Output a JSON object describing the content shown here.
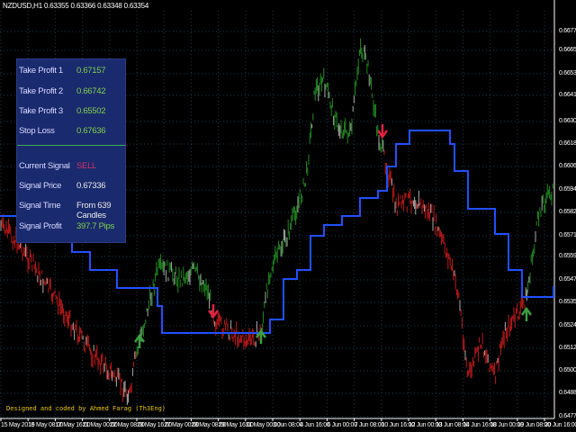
{
  "header": {
    "title": "NZDUSD,H1  0.63355 0.63366 0.63348 0.63354"
  },
  "panel": {
    "rows": [
      {
        "label": "Take Profit 1",
        "value": "0.67157",
        "color": "#7fd04a"
      },
      {
        "label": "Take Profit 2",
        "value": "0.66742",
        "color": "#7fd04a"
      },
      {
        "label": "Take Profit 3",
        "value": "0.65502",
        "color": "#7fd04a"
      },
      {
        "label": "Stop Loss",
        "value": "0.67636",
        "color": "#7fd04a"
      },
      {
        "label": "Current Signal",
        "value": "SELL",
        "color": "#d0306a"
      },
      {
        "label": "Signal Price",
        "value": "0.67336",
        "color": "#e8e8e8"
      },
      {
        "label": "Signal Time",
        "value": "From 639 Candles",
        "color": "#e8e8e8"
      },
      {
        "label": "Signal Profit",
        "value": "397.7  Pips",
        "color": "#7fd04a"
      }
    ]
  },
  "credit": "Designed and coded by Ahmed Farag (Th3Eng)",
  "price_axis": [
    "0.66770",
    "0.66650",
    "0.66535",
    "0.66415",
    "0.66300",
    "0.66180",
    "0.66065",
    "0.65945",
    "0.65825",
    "0.65710",
    "0.65590",
    "0.65475",
    "0.65355",
    "0.65240",
    "0.65120",
    "0.65005",
    "0.64885",
    "0.64770"
  ],
  "time_axis": [
    "15 May 2019",
    "16 May 08:00",
    "17 May 16:00",
    "21 May 00:00",
    "22 May 08:00",
    "23 May 16:00",
    "27 May 00:00",
    "28 May 08:00",
    "29 May 16:00",
    "31 May 00:00",
    "3 Jun 08:00",
    "4 Jun 16:00",
    "6 Jun 00:00",
    "7 Jun 08:00",
    "10 Jun 16:00",
    "12 Jun 00:00",
    "13 Jun 08:00",
    "14 Jun 16:00",
    "18 Jun 00:00",
    "19 Jun 08:00",
    "20 Jun 16:00"
  ],
  "colors": {
    "bull": "#1f8a1f",
    "bear": "#c01818",
    "trend_line": "#2050ff",
    "buy_arrow": "#3aa040",
    "sell_arrow": "#e02040",
    "grid": "#1a3a4a"
  },
  "signals": [
    {
      "type": "buy",
      "time": "23 May 16:00"
    },
    {
      "type": "sell",
      "time": "29 May 16:00"
    },
    {
      "type": "buy",
      "time": "31 May 00:00"
    },
    {
      "type": "sell",
      "time": "10 Jun 16:00"
    },
    {
      "type": "buy",
      "time": "20 Jun 16:00"
    }
  ]
}
